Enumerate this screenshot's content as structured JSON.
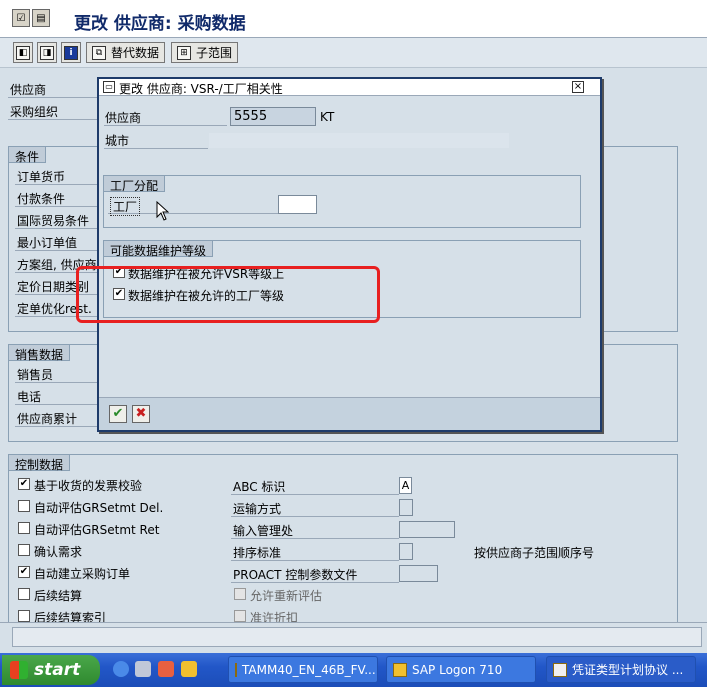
{
  "window": {
    "title": "更改 供应商: 采购数据"
  },
  "toolbar": {
    "alt_data_label": "替代数据",
    "subrange_label": "子范围"
  },
  "header": {
    "vendor_label": "供应商",
    "purch_org_label": "采购组织"
  },
  "conditions": {
    "title": "条件",
    "rows": [
      "订单货币",
      "付款条件",
      "国际贸易条件",
      "最小订单值",
      "方案组, 供应商",
      "定价日期类别",
      "定单优化rest."
    ]
  },
  "sales": {
    "title": "销售数据",
    "rows": [
      "销售员",
      "电话",
      "供应商累计"
    ]
  },
  "control": {
    "title": "控制数据",
    "left": [
      {
        "label": "基于收货的发票校验",
        "checked": true
      },
      {
        "label": "自动评估GRSetmt Del.",
        "checked": false
      },
      {
        "label": "自动评估GRSetmt Ret",
        "checked": false
      },
      {
        "label": "确认需求",
        "checked": false
      },
      {
        "label": "自动建立采购订单",
        "checked": true
      },
      {
        "label": "后续结算",
        "checked": false
      },
      {
        "label": "后续结算索引",
        "checked": false
      }
    ],
    "abc_label": "ABC 标识",
    "abc_value": "A",
    "shipping_label": "运输方式",
    "entry_office_label": "输入管理处",
    "sort_label": "排序标准",
    "sort_note": "按供应商子范围顺序号",
    "proact_label": "PROACT 控制参数文件",
    "reeval_label": "允许重新评估",
    "discount_label": "准许折扣"
  },
  "dialog": {
    "title": "更改 供应商: VSR-/工厂相关性",
    "vendor_label": "供应商",
    "vendor_value": "5555",
    "vendor_suffix": "KT",
    "city_label": "城市",
    "plant_group_title": "工厂分配",
    "plant_label": "工厂",
    "levels_group_title": "可能数据维护等级",
    "level_vsr": {
      "label": "数据维护在被允许VSR等级上",
      "checked": true
    },
    "level_plant": {
      "label": "数据维护在被允许的工厂等级",
      "checked": true
    }
  },
  "taskbar": {
    "start_label": "start",
    "tasks": [
      "TAMM40_EN_46B_FV...",
      "SAP Logon 710",
      "凭证类型计划协议 ..."
    ]
  }
}
